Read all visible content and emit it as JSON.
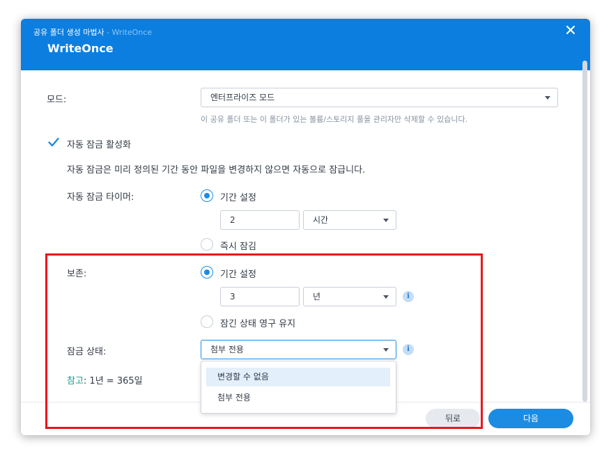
{
  "header": {
    "wizard_title": "공유 폴더 생성 마법사",
    "separator": " - ",
    "wizard_subtitle": "WriteOnce",
    "title": "WriteOnce"
  },
  "mode": {
    "label": "모드:",
    "value": "엔터프라이즈 모드",
    "hint": "이 공유 폴더 또는 이 폴더가 있는 볼륨/스토리지 풀을 관리자만 삭제할 수 있습니다."
  },
  "autolock": {
    "checkbox_label": "자동 잠금 활성화",
    "checked": true,
    "description": "자동 잠금은 미리 정의된 기간 동안 파일을 변경하지 않으면 자동으로 잠급니다.",
    "timer_label": "자동 잠금 타이머:",
    "option_period": "기간 설정",
    "period_value": "2",
    "period_unit": "시간",
    "option_immediate": "즉시 잠김"
  },
  "retention": {
    "label": "보존:",
    "option_period": "기간 설정",
    "period_value": "3",
    "period_unit": "년",
    "option_permanent": "잠긴 상태 영구 유지"
  },
  "lock_state": {
    "label": "잠금 상태:",
    "value": "첨부 전용",
    "options": [
      "변경할 수 없음",
      "첨부 전용"
    ]
  },
  "note": {
    "prefix": "참고",
    "text": ": 1년 = 365일"
  },
  "footer": {
    "back_label": "뒤로",
    "next_label": "다음"
  },
  "colors": {
    "header": "#0b7ee0",
    "accent": "#1c8ce3",
    "highlight_box": "#e8161b",
    "note_prefix": "#1a9a8a"
  },
  "icons": [
    "close-icon",
    "check-icon",
    "info-icon",
    "chevron-down-icon"
  ]
}
